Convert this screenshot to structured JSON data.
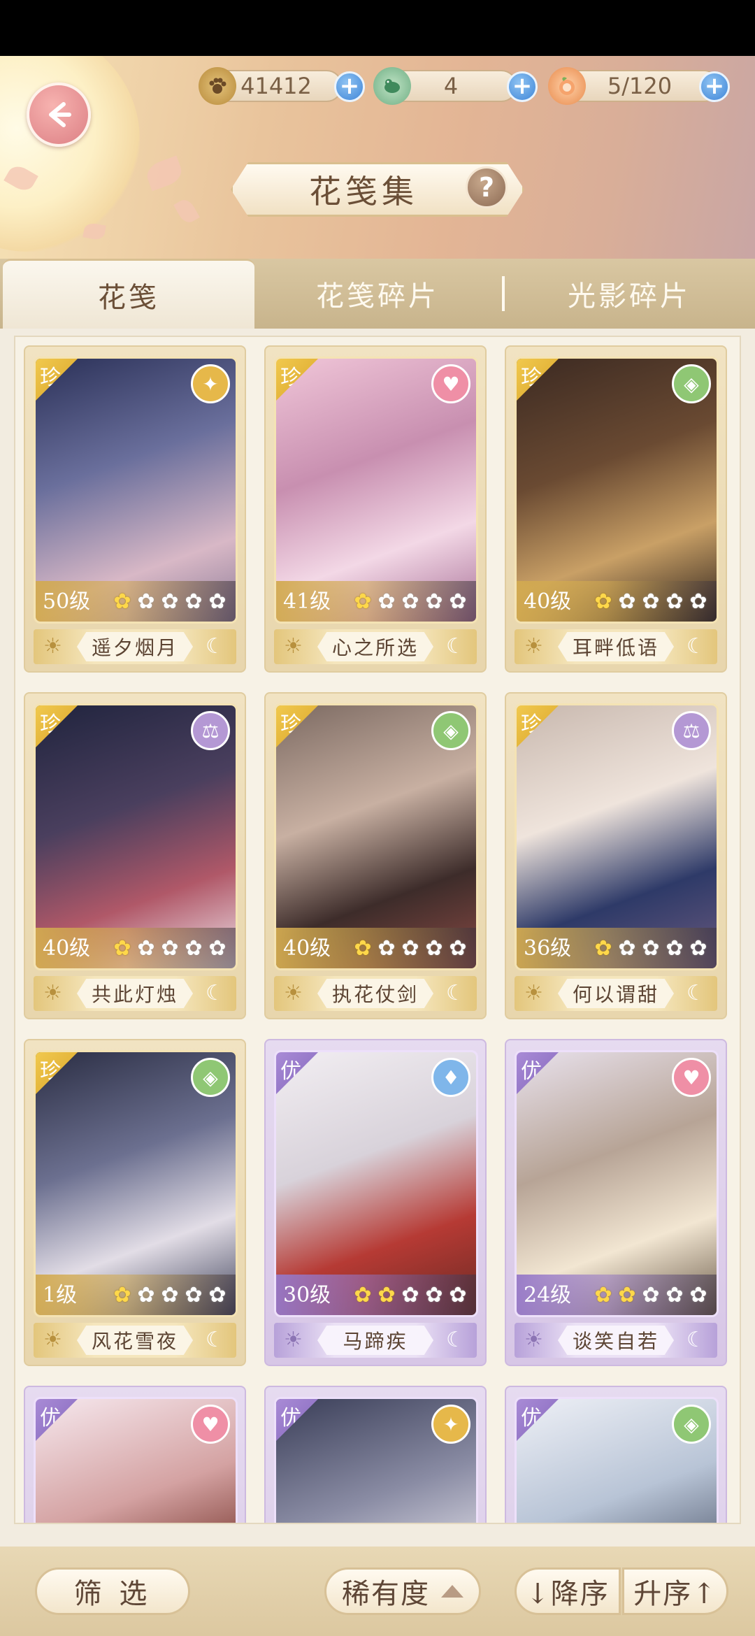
{
  "header": {
    "title": "花笺集",
    "resources": [
      {
        "icon": "paw-coin-icon",
        "value": "41412"
      },
      {
        "icon": "jade-bird-icon",
        "value": "4"
      },
      {
        "icon": "peach-bun-icon",
        "value": "5/120"
      }
    ],
    "plus": "+",
    "help": "?"
  },
  "tabs": [
    {
      "label": "花笺",
      "active": true
    },
    {
      "label": "花笺碎片",
      "active": false
    },
    {
      "label": "光影碎片",
      "active": false
    }
  ],
  "cards": [
    {
      "rarity": "珍",
      "level": "50级",
      "stars": 1,
      "name": "遥夕烟月",
      "attr": "bird-icon",
      "attr_color": "#e6b84a",
      "theme": "gold"
    },
    {
      "rarity": "珍",
      "level": "41级",
      "stars": 1,
      "name": "心之所选",
      "attr": "heart-icon",
      "attr_color": "#ef8fa6",
      "theme": "gold"
    },
    {
      "rarity": "珍",
      "level": "40级",
      "stars": 1,
      "name": "耳畔低语",
      "attr": "diamond-icon",
      "attr_color": "#8fc774",
      "theme": "gold"
    },
    {
      "rarity": "珍",
      "level": "40级",
      "stars": 1,
      "name": "共此灯烛",
      "attr": "scale-icon",
      "attr_color": "#b498d4",
      "theme": "gold"
    },
    {
      "rarity": "珍",
      "level": "40级",
      "stars": 1,
      "name": "执花仗剑",
      "attr": "diamond-icon",
      "attr_color": "#8fc774",
      "theme": "gold"
    },
    {
      "rarity": "珍",
      "level": "36级",
      "stars": 1,
      "name": "何以谓甜",
      "attr": "scale-icon",
      "attr_color": "#b498d4",
      "theme": "gold"
    },
    {
      "rarity": "珍",
      "level": "1级",
      "stars": 1,
      "name": "风花雪夜",
      "attr": "diamond-icon",
      "attr_color": "#8fc774",
      "theme": "gold"
    },
    {
      "rarity": "优",
      "level": "30级",
      "stars": 2,
      "name": "马蹄疾",
      "attr": "flame-icon",
      "attr_color": "#7fb6ea",
      "theme": "purple"
    },
    {
      "rarity": "优",
      "level": "24级",
      "stars": 2,
      "name": "谈笑自若",
      "attr": "heart-icon",
      "attr_color": "#ef8fa6",
      "theme": "purple"
    },
    {
      "rarity": "优",
      "attr": "heart-icon",
      "attr_color": "#ef8fa6",
      "theme": "purple"
    },
    {
      "rarity": "优",
      "attr": "bird-icon",
      "attr_color": "#e6b84a",
      "theme": "purple"
    },
    {
      "rarity": "优",
      "attr": "diamond-icon",
      "attr_color": "#8fc774",
      "theme": "purple"
    }
  ],
  "bottom": {
    "filter": "筛 选",
    "sort_by": "稀有度",
    "desc": "↓降序",
    "asc": "升序↑"
  }
}
